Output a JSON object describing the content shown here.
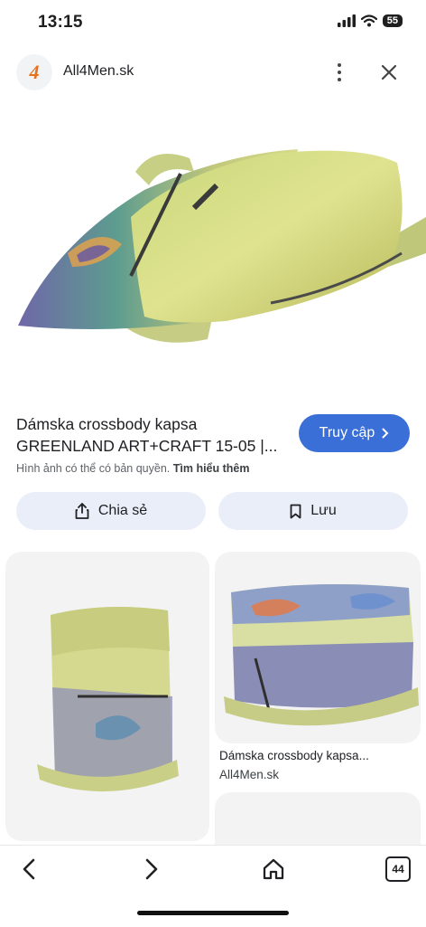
{
  "status_bar": {
    "time": "13:15",
    "battery": "55"
  },
  "header": {
    "site_name": "All4Men.sk",
    "logo_text": "4"
  },
  "result": {
    "title": "Dámska crossbody kapsa GREENLAND ART+CRAFT 15-05 |...",
    "visit_label": "Truy cập",
    "copyright_text": "Hình ảnh có thể có bản quyền.",
    "learn_more": "Tìm hiểu thêm",
    "share_label": "Chia sẻ",
    "save_label": "Lưu"
  },
  "grid": {
    "items": [
      {
        "caption": "Dámska crossbody kapsa...",
        "source": "All4Men.sk"
      }
    ]
  },
  "bottom_nav": {
    "tabs_count": "44"
  },
  "colors": {
    "accent": "#3b6fd8",
    "button_bg": "#e9eef8",
    "logo": "#e8711c"
  }
}
